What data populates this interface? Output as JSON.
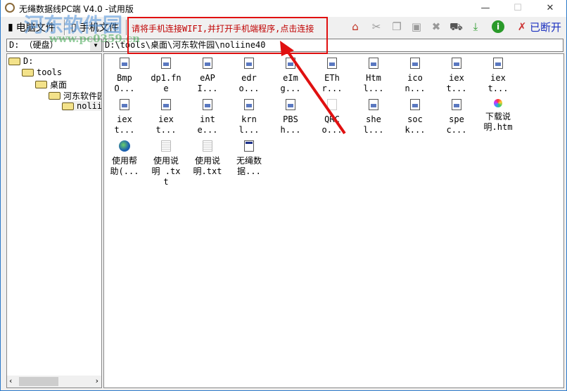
{
  "window": {
    "title": "无绳数据线PC端 V4.0 -试用版",
    "minimize": "—",
    "maximize": "☐",
    "close": "✕"
  },
  "toolbar": {
    "tab_pc": "电脑文件",
    "tab_phone": "手机文件",
    "message": "请将手机连接WIFI,并打开手机端程序,点击连接",
    "status": "已断开",
    "icons": [
      "home-icon",
      "cut-icon",
      "copy-icon",
      "paste-icon",
      "delete-icon",
      "cart-icon",
      "download-icon",
      "info-icon",
      "disconnected-icon"
    ]
  },
  "drive": {
    "value": "D: （硬盘）"
  },
  "path": {
    "value": "D:\\tools\\桌面\\河东软件园\\noliine40"
  },
  "tree": [
    "D:",
    "tools",
    "桌面",
    "河东软件园",
    "noliine40"
  ],
  "files": [
    {
      "name": "BmpO...",
      "type": "dll"
    },
    {
      "name": "dp1.fne",
      "type": "dll"
    },
    {
      "name": "eAPI...",
      "type": "dll"
    },
    {
      "name": "edro...",
      "type": "dll"
    },
    {
      "name": "eImg...",
      "type": "dll"
    },
    {
      "name": "EThr...",
      "type": "dll"
    },
    {
      "name": "Html...",
      "type": "dll"
    },
    {
      "name": "icon...",
      "type": "dll"
    },
    {
      "name": "iext...",
      "type": "dll"
    },
    {
      "name": "iext...",
      "type": "dll"
    },
    {
      "name": "iext...",
      "type": "dll"
    },
    {
      "name": "iext...",
      "type": "dll"
    },
    {
      "name": "inte...",
      "type": "dll"
    },
    {
      "name": "krnl...",
      "type": "dll"
    },
    {
      "name": "PBSh...",
      "type": "dll"
    },
    {
      "name": "QRCo...",
      "type": "img"
    },
    {
      "name": "shel...",
      "type": "dll"
    },
    {
      "name": "sock...",
      "type": "dll"
    },
    {
      "name": "spec...",
      "type": "dll"
    },
    {
      "name": "下载说明.htm",
      "type": "htm"
    },
    {
      "name": "使用帮助(...",
      "type": "globe"
    },
    {
      "name": "使用说明 .txt",
      "type": "txt"
    },
    {
      "name": "使用说明.txt",
      "type": "txt"
    },
    {
      "name": "无绳数据...",
      "type": "exe"
    }
  ],
  "watermark": {
    "text": "河东软件园",
    "url": "www.pc0359.cn"
  },
  "colors": {
    "annotation": "#e01010",
    "message": "#c00000",
    "status": "#1a2fbf"
  }
}
